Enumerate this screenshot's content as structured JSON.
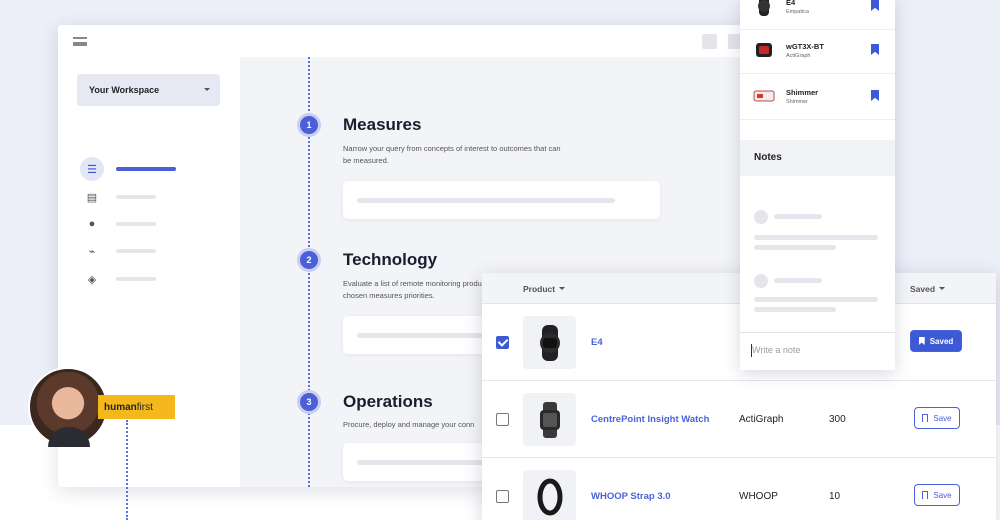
{
  "sidebar": {
    "workspace_label": "Your Workspace",
    "nav_icons": [
      "list-icon",
      "document-icon",
      "user-icon",
      "activity-icon",
      "compass-icon"
    ]
  },
  "steps": [
    {
      "number": "1",
      "title": "Measures",
      "description": "Narrow your query from concepts of interest to outcomes that can be measured."
    },
    {
      "number": "2",
      "title": "Technology",
      "description": "Evaluate a list of remote monitoring products based on your chosen measures priorities."
    },
    {
      "number": "3",
      "title": "Operations",
      "description": "Procure, deploy and manage your conn"
    }
  ],
  "saved_products": [
    {
      "name": "E4",
      "maker": "Empatica"
    },
    {
      "name": "wGT3X-BT",
      "maker": "ActiGraph"
    },
    {
      "name": "Shimmer",
      "maker": "Shimmer"
    }
  ],
  "notes": {
    "title": "Notes",
    "input_placeholder": "Write a note"
  },
  "table": {
    "col_product": "Product",
    "col_saved": "Saved",
    "rows": [
      {
        "name": "E4",
        "brand": "",
        "count": "",
        "saved": true,
        "checked": true,
        "save_label": "Saved"
      },
      {
        "name": "CentrePoint Insight Watch",
        "brand": "ActiGraph",
        "count": "300",
        "saved": false,
        "checked": false,
        "save_label": "Save"
      },
      {
        "name": "WHOOP Strap 3.0",
        "brand": "WHOOP",
        "count": "10",
        "saved": false,
        "checked": false,
        "save_label": "Save"
      }
    ]
  },
  "brand": {
    "part1": "human",
    "part2": "first"
  },
  "colors": {
    "accent": "#3c5ad6",
    "tag": "#f5b81c",
    "background": "#eceef8"
  }
}
